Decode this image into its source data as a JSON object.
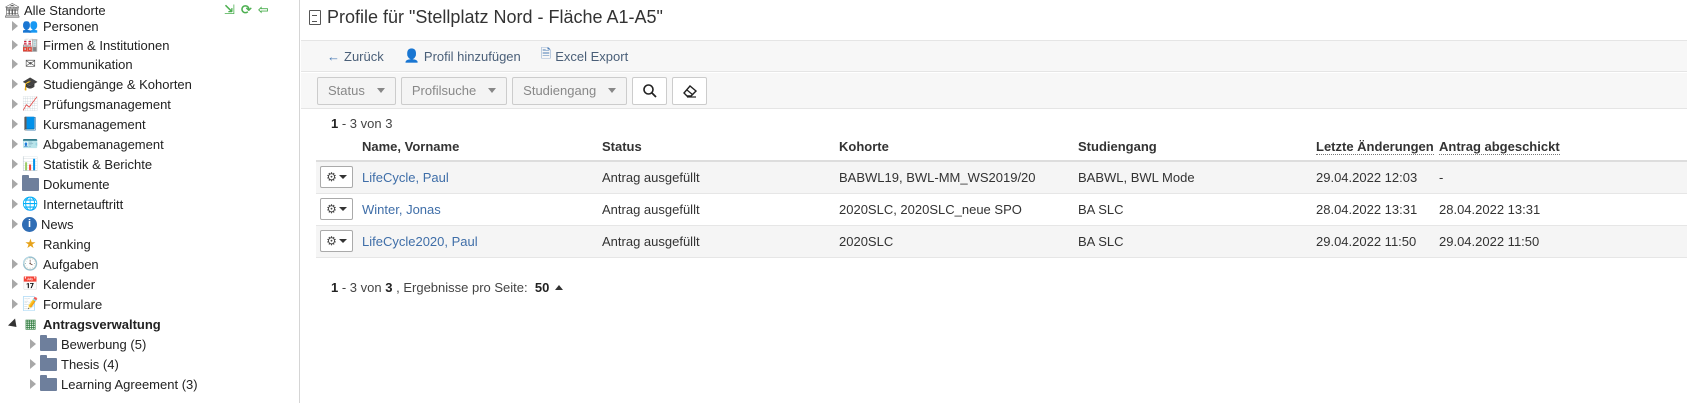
{
  "sidebar": {
    "root_label": "Alle Standorte",
    "items": [
      {
        "label": "Personen",
        "icon": "persons-icon",
        "expanded": false
      },
      {
        "label": "Firmen & Institutionen",
        "icon": "companies-icon",
        "expanded": false
      },
      {
        "label": "Kommunikation",
        "icon": "mail-icon",
        "expanded": false
      },
      {
        "label": "Studiengänge & Kohorten",
        "icon": "graduation-icon",
        "expanded": false
      },
      {
        "label": "Prüfungsmanagement",
        "icon": "exam-chart-icon",
        "expanded": false
      },
      {
        "label": "Kursmanagement",
        "icon": "book-icon",
        "expanded": false
      },
      {
        "label": "Abgabemanagement",
        "icon": "id-card-icon",
        "expanded": false
      },
      {
        "label": "Statistik & Berichte",
        "icon": "bar-chart-icon",
        "expanded": false
      },
      {
        "label": "Dokumente",
        "icon": "folder-icon",
        "expanded": false
      },
      {
        "label": "Internetauftritt",
        "icon": "globe-icon",
        "expanded": false
      },
      {
        "label": "News",
        "icon": "info-icon",
        "expanded": false
      },
      {
        "label": "Ranking",
        "icon": "star-icon",
        "expanded": false
      },
      {
        "label": "Aufgaben",
        "icon": "clock-icon",
        "expanded": false
      },
      {
        "label": "Kalender",
        "icon": "calendar-icon",
        "expanded": false
      },
      {
        "label": "Formulare",
        "icon": "form-icon",
        "expanded": false
      },
      {
        "label": "Antragsverwaltung",
        "icon": "application-icon",
        "expanded": true
      }
    ],
    "children": [
      {
        "label": "Bewerbung (5)"
      },
      {
        "label": "Thesis (4)"
      },
      {
        "label": "Learning Agreement (3)"
      }
    ]
  },
  "page": {
    "title": "Profile für \"Stellplatz Nord - Fläche A1-A5\""
  },
  "toolbar": {
    "back_label": "Zurück",
    "add_profile_label": "Profil hinzufügen",
    "excel_export_label": "Excel Export"
  },
  "filters": {
    "status_label": "Status",
    "profile_search_label": "Profilsuche",
    "program_label": "Studiengang"
  },
  "pagination_top": {
    "range": "1",
    "range_end": "3",
    "of_label": "von",
    "total": "3"
  },
  "table": {
    "headers": {
      "name": "Name, Vorname",
      "status": "Status",
      "cohort": "Kohorte",
      "program": "Studiengang",
      "last_changes": "Letzte Änderungen",
      "submitted": "Antrag abgeschickt"
    },
    "rows": [
      {
        "name": "LifeCycle, Paul",
        "status": "Antrag ausgefüllt",
        "cohort": "BABWL19, BWL-MM_WS2019/20",
        "program": "BABWL, BWL Mode",
        "last_changes": "29.04.2022 12:03",
        "submitted": "-"
      },
      {
        "name": "Winter, Jonas",
        "status": "Antrag ausgefüllt",
        "cohort": "2020SLC, 2020SLC_neue SPO",
        "program": "BA SLC",
        "last_changes": "28.04.2022 13:31",
        "submitted": "28.04.2022 13:31"
      },
      {
        "name": "LifeCycle2020, Paul",
        "status": "Antrag ausgefüllt",
        "cohort": "2020SLC",
        "program": "BA SLC",
        "last_changes": "29.04.2022 11:50",
        "submitted": "29.04.2022 11:50"
      }
    ]
  },
  "pagination_bottom": {
    "range": "1",
    "range_end": "3",
    "of_label": "von",
    "total": "3",
    "per_page_label": ", Ergebnisse pro Seite:",
    "per_page_value": "50"
  }
}
